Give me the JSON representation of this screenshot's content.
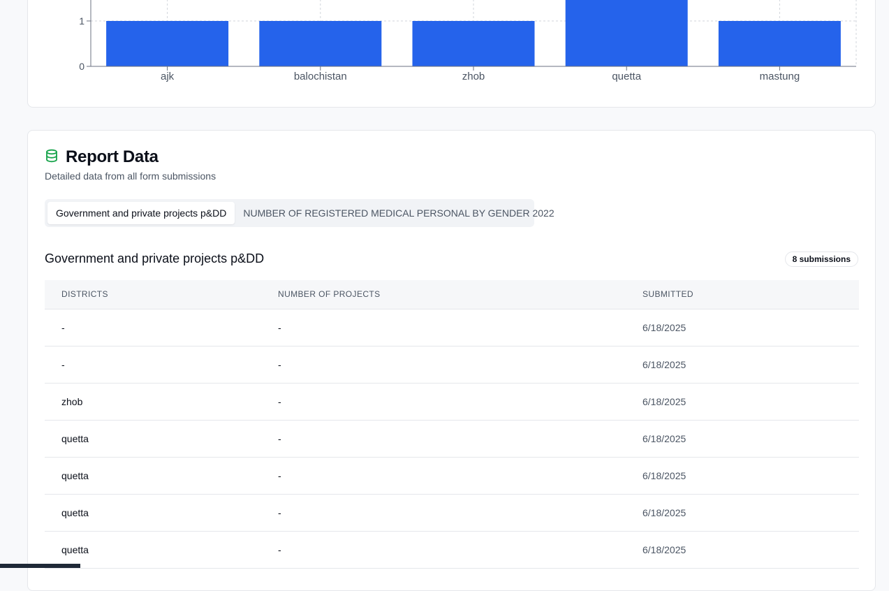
{
  "chart_data": {
    "type": "bar",
    "categories": [
      "ajk",
      "balochistan",
      "zhob",
      "quetta",
      "mastung"
    ],
    "values": [
      1,
      1,
      1,
      2,
      1
    ],
    "yticks": [
      "0",
      "1"
    ],
    "ylim": [
      0,
      2
    ],
    "bar_color": "#2563eb",
    "grid": true
  },
  "report": {
    "title": "Report Data",
    "icon": "database-icon",
    "icon_color": "#16a34a",
    "description": "Detailed data from all form submissions",
    "tabs": [
      {
        "label": "Government and private projects p&DD"
      },
      {
        "label": "NUMBER OF REGISTERED MEDICAL PERSONAL BY GENDER 2022"
      }
    ],
    "section_title": "Government and private projects p&DD",
    "submissions_badge": "8 submissions",
    "columns": [
      "DISTRICTS",
      "NUMBER OF PROJECTS",
      "SUBMITTED"
    ],
    "rows": [
      {
        "district": "-",
        "projects": "-",
        "submitted": "6/18/2025"
      },
      {
        "district": "-",
        "projects": "-",
        "submitted": "6/18/2025"
      },
      {
        "district": "zhob",
        "projects": "-",
        "submitted": "6/18/2025"
      },
      {
        "district": "quetta",
        "projects": "-",
        "submitted": "6/18/2025"
      },
      {
        "district": "quetta",
        "projects": "-",
        "submitted": "6/18/2025"
      },
      {
        "district": "quetta",
        "projects": "-",
        "submitted": "6/18/2025"
      },
      {
        "district": "quetta",
        "projects": "-",
        "submitted": "6/18/2025"
      }
    ]
  }
}
